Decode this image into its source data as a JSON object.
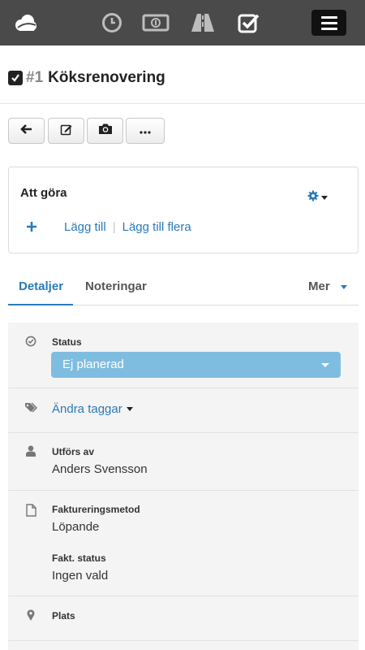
{
  "nav": {
    "icons": [
      "cloud-logo-icon",
      "clock-icon",
      "money-icon",
      "road-icon",
      "checkbox-icon",
      "hamburger-menu-icon"
    ],
    "active": "checkbox-icon"
  },
  "task": {
    "number": "#1",
    "name": "Köksrenovering"
  },
  "toolbar": {
    "buttons": [
      "back-arrow-icon",
      "edit-icon",
      "camera-icon",
      "more-icon"
    ]
  },
  "todo": {
    "heading": "Att göra",
    "add": "Lägg till",
    "add_many": "Lägg till flera"
  },
  "tabs": {
    "details": "Detaljer",
    "notes": "Noteringar",
    "more": "Mer"
  },
  "details": {
    "status_label": "Status",
    "status_value": "Ej planerad",
    "tags_link": "Ändra taggar",
    "performed_by_label": "Utförs av",
    "performed_by_value": "Anders Svensson",
    "billing_method_label": "Faktureringsmetod",
    "billing_method_value": "Löpande",
    "billing_status_label": "Fakt. status",
    "billing_status_value": "Ingen vald",
    "location_label": "Plats"
  },
  "colors": {
    "topbar": "#4a4a4a",
    "accent": "#2a7ab8",
    "status_select": "#7fbde0"
  }
}
